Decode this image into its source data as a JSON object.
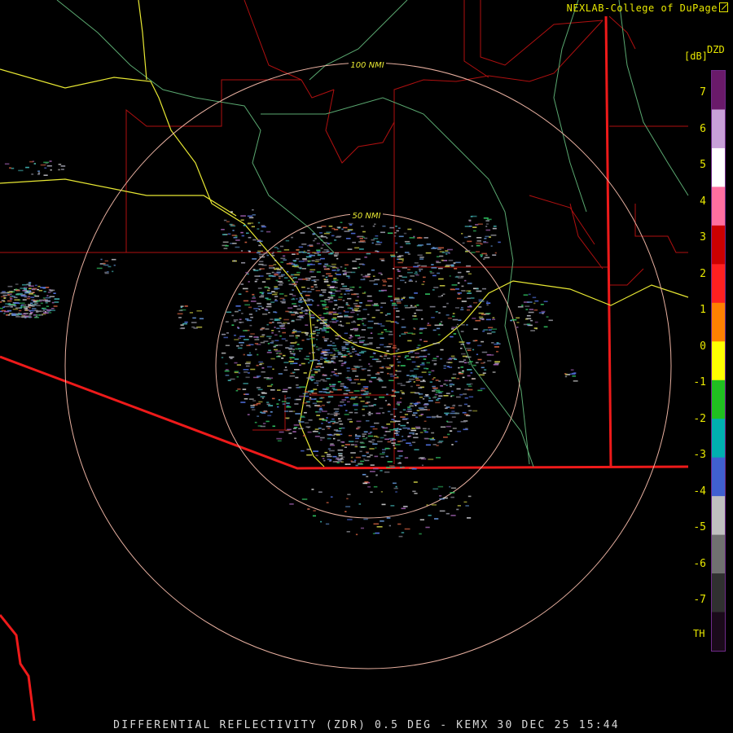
{
  "credit": "NEXLAB-College of DuPage",
  "legend": {
    "product": "DZD",
    "unit": "[dB]",
    "ticks": [
      "7",
      "6",
      "5",
      "4",
      "3",
      "2",
      "1",
      "0",
      "-1",
      "-2",
      "-3",
      "-4",
      "-5",
      "-6",
      "-7"
    ],
    "th_label": "TH",
    "colors": [
      "#6a1a6a",
      "#c8a0d8",
      "#ffffff",
      "#ff6fa0",
      "#cc0000",
      "#ff2020",
      "#ff8000",
      "#ffff00",
      "#20c020",
      "#00b0b0",
      "#4060d0",
      "#c0c0c0",
      "#707070",
      "#303030",
      "#1a0a1a"
    ]
  },
  "range_rings": [
    "100 NMI",
    "50 NMI"
  ],
  "footer": "DIFFERENTIAL REFLECTIVITY (ZDR) 0.5 DEG - KEMX 30 DEC 25 15:44"
}
